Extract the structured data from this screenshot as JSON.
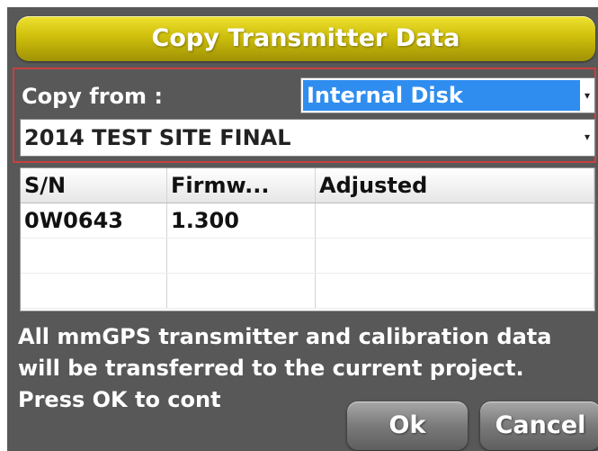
{
  "dialog": {
    "title": "Copy Transmitter Data"
  },
  "source": {
    "copy_from_label": "Copy from :",
    "disk_value": "Internal Disk",
    "site_value": "2014 TEST SITE FINAL"
  },
  "table": {
    "headers": [
      "S/N",
      "Firmw...",
      "Adjusted"
    ],
    "rows": [
      [
        "0W0643",
        "1.300",
        ""
      ],
      [
        "",
        "",
        ""
      ],
      [
        "",
        "",
        ""
      ]
    ]
  },
  "message": "All mmGPS transmitter and calibration data will be transferred to the current project. Press OK to cont",
  "buttons": {
    "ok": "Ok",
    "cancel": "Cancel"
  },
  "colors": {
    "title_bar": "#cfbf0c",
    "selection": "#2f8df0",
    "panel_bg": "#585858",
    "outline": "#c84040"
  }
}
